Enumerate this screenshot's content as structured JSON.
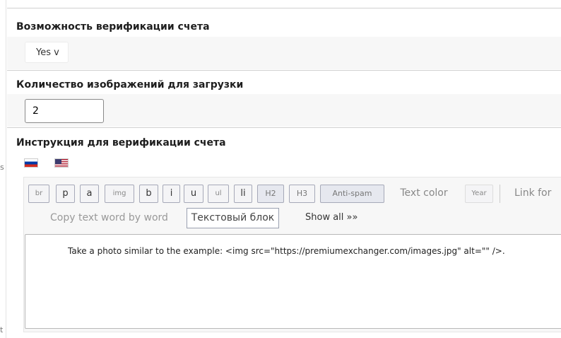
{
  "sections": {
    "verification": {
      "title": "Возможность верификации счета",
      "select_value": "Yes v"
    },
    "image_count": {
      "title": "Количество изображений для загрузки",
      "value": "2"
    },
    "instruction": {
      "title": "Инструкция для верификации счета"
    }
  },
  "languages": [
    {
      "code": "ru",
      "icon": "russia-flag-icon"
    },
    {
      "code": "en",
      "icon": "usa-flag-icon"
    }
  ],
  "toolbar": {
    "br": "br",
    "p": "p",
    "a": "a",
    "img": "img",
    "b": "b",
    "i": "i",
    "u": "u",
    "ul": "ul",
    "li": "li",
    "h2": "H2",
    "h3": "H3",
    "antispam": "Anti-spam",
    "text_color": "Text color",
    "year": "Year",
    "link_for": "Link for",
    "copy_word": "Copy text word by word",
    "text_block": "Текстовый блок",
    "show_all": "Show all »»"
  },
  "editor": {
    "content": "Take a photo similar to the example: <img src=\"https://premiumexchanger.com/images.jpg\" alt=\"\" />."
  },
  "left_marks": [
    "s",
    "t"
  ]
}
